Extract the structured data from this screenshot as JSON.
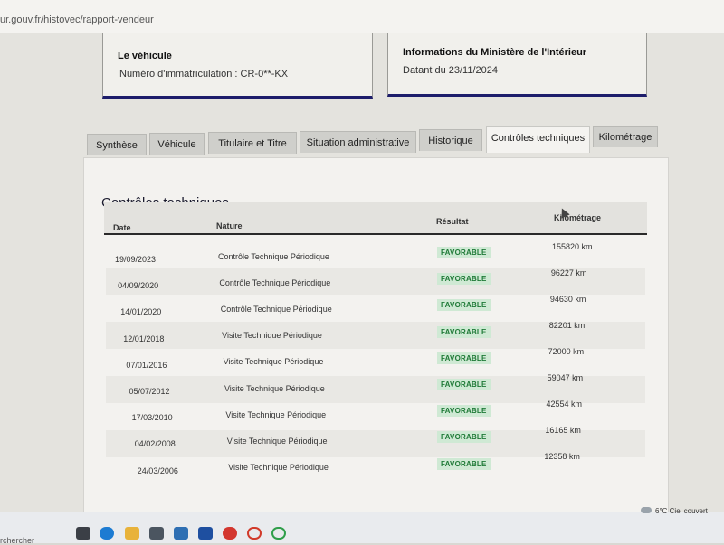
{
  "browser": {
    "url": "ur.gouv.fr/histovec/rapport-vendeur"
  },
  "vehicle_card": {
    "title": "Le véhicule",
    "plate": "Numéro d'immatriculation : CR-0**-KX"
  },
  "ministry_card": {
    "title": "Informations du Ministère de l'Intérieur",
    "date": "Datant du 23/11/2024"
  },
  "tabs": [
    {
      "label": "Synthèse"
    },
    {
      "label": "Véhicule"
    },
    {
      "label": "Titulaire et Titre"
    },
    {
      "label": "Situation administrative"
    },
    {
      "label": "Historique"
    },
    {
      "label": "Contrôles techniques",
      "active": true
    },
    {
      "label": "Kilométrage"
    }
  ],
  "section": {
    "title": "Contrôles techniques"
  },
  "table": {
    "headers": {
      "date": "Date",
      "nature": "Nature",
      "result": "Résultat",
      "mileage": "Kilométrage"
    },
    "rows": [
      {
        "date": "19/09/2023",
        "nature": "Contrôle Technique Périodique",
        "result": "FAVORABLE",
        "mileage": "155820 km"
      },
      {
        "date": "04/09/2020",
        "nature": "Contrôle Technique Périodique",
        "result": "FAVORABLE",
        "mileage": "96227 km"
      },
      {
        "date": "14/01/2020",
        "nature": "Contrôle Technique Périodique",
        "result": "FAVORABLE",
        "mileage": "94630 km"
      },
      {
        "date": "12/01/2018",
        "nature": "Visite Technique Périodique",
        "result": "FAVORABLE",
        "mileage": "82201 km"
      },
      {
        "date": "07/01/2016",
        "nature": "Visite Technique Périodique",
        "result": "FAVORABLE",
        "mileage": "72000 km"
      },
      {
        "date": "05/07/2012",
        "nature": "Visite Technique Périodique",
        "result": "FAVORABLE",
        "mileage": "59047 km"
      },
      {
        "date": "17/03/2010",
        "nature": "Visite Technique Périodique",
        "result": "FAVORABLE",
        "mileage": "42554 km"
      },
      {
        "date": "04/02/2008",
        "nature": "Visite Technique Périodique",
        "result": "FAVORABLE",
        "mileage": "16165 km"
      },
      {
        "date": "24/03/2006",
        "nature": "Visite Technique Périodique",
        "result": "FAVORABLE",
        "mileage": "12358 km"
      }
    ]
  },
  "taskbar": {
    "search_text": "rchercher",
    "weather": "6°C  Ciel couvert"
  },
  "colors": {
    "accent_navy": "#1d1d6b",
    "badge_green": "#1f7a37",
    "badge_bg": "#cfe9d4"
  }
}
